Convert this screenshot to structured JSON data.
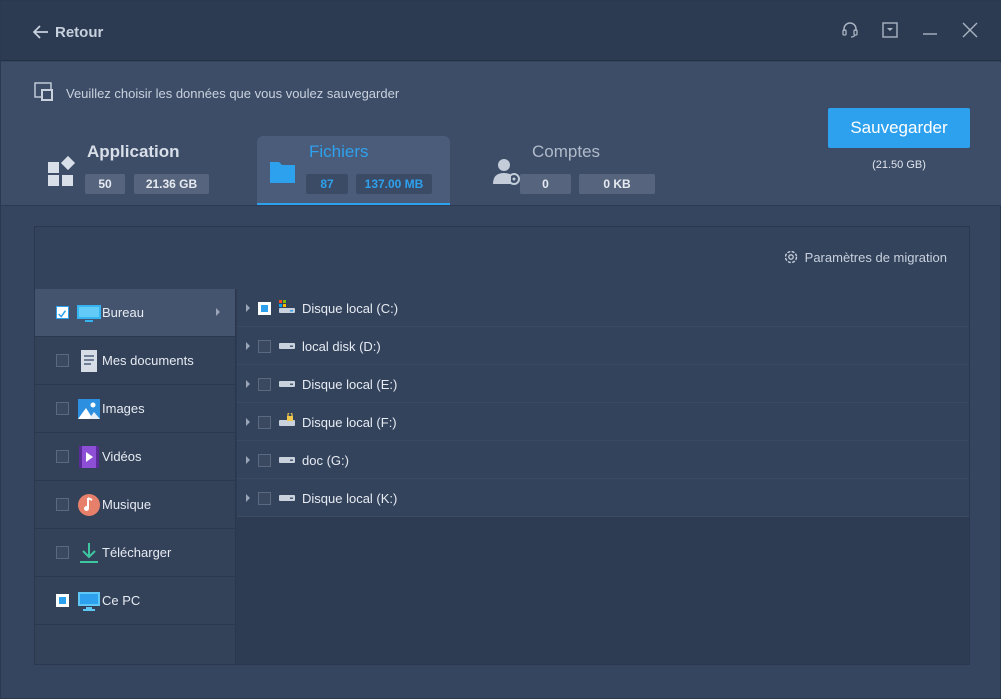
{
  "titlebar": {
    "back_label": "Retour"
  },
  "header": {
    "instruction": "Veuillez choisir les données que vous voulez sauvegarder",
    "tabs": [
      {
        "title": "Application",
        "count": "50",
        "size": "21.36 GB",
        "icon": "apps-icon",
        "active": false
      },
      {
        "title": "Fichiers",
        "count": "87",
        "size": "137.00 MB",
        "icon": "folder-icon",
        "active": true
      },
      {
        "title": "Comptes",
        "count": "0",
        "size": "0 KB",
        "icon": "account-settings-icon",
        "active": false
      }
    ],
    "save_label": "Sauvegarder",
    "save_size": "(21.50 GB)"
  },
  "panel": {
    "migration_label": "Paramètres de migration",
    "categories": [
      {
        "label": "Bureau",
        "state": "checked",
        "icon": "desktop-icon"
      },
      {
        "label": "Mes documents",
        "state": "unchecked",
        "icon": "documents-icon"
      },
      {
        "label": "Images",
        "state": "unchecked",
        "icon": "images-icon"
      },
      {
        "label": "Vidéos",
        "state": "unchecked",
        "icon": "videos-icon"
      },
      {
        "label": "Musique",
        "state": "unchecked",
        "icon": "music-icon"
      },
      {
        "label": "Télécharger",
        "state": "unchecked",
        "icon": "download-icon"
      },
      {
        "label": "Ce PC",
        "state": "partial",
        "icon": "computer-icon"
      }
    ],
    "drives": [
      {
        "label": "Disque local (C:)",
        "state": "partial",
        "icon": "system-drive-icon"
      },
      {
        "label": "local disk (D:)",
        "state": "unchecked",
        "icon": "drive-icon"
      },
      {
        "label": "Disque local (E:)",
        "state": "unchecked",
        "icon": "drive-icon"
      },
      {
        "label": "Disque local (F:)",
        "state": "unchecked",
        "icon": "locked-drive-icon"
      },
      {
        "label": "doc (G:)",
        "state": "unchecked",
        "icon": "drive-icon"
      },
      {
        "label": "Disque local (K:)",
        "state": "unchecked",
        "icon": "drive-icon"
      }
    ]
  },
  "colors": {
    "accent": "#2ea1ee",
    "background": "#354560"
  }
}
